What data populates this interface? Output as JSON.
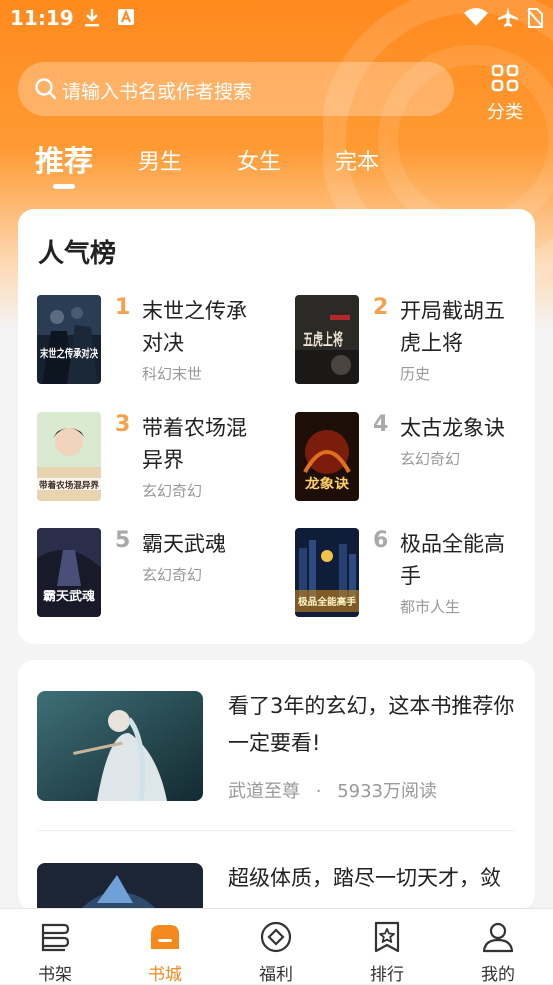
{
  "status_bar": {
    "time": "11:19",
    "icons": [
      "download-icon",
      "a-notification-icon",
      "wifi-icon",
      "airplane-mode-icon",
      "no-sim-icon"
    ]
  },
  "search": {
    "placeholder": "请输入书名或作者搜索",
    "category_label": "分类"
  },
  "tabs": [
    {
      "label": "推荐",
      "active": true
    },
    {
      "label": "男生",
      "active": false
    },
    {
      "label": "女生",
      "active": false
    },
    {
      "label": "完本",
      "active": false
    }
  ],
  "popular": {
    "title": "人气榜",
    "books": [
      {
        "rank": "1",
        "title": "末世之传承对决",
        "genre": "科幻末世",
        "cover_text": "末世之传承对决"
      },
      {
        "rank": "2",
        "title": "开局截胡五虎上将",
        "genre": "历史",
        "cover_text": "五虎上将"
      },
      {
        "rank": "3",
        "title": "带着农场混异界",
        "genre": "玄幻奇幻",
        "cover_text": "带着农场混异界"
      },
      {
        "rank": "4",
        "title": "太古龙象诀",
        "genre": "玄幻奇幻",
        "cover_text": "龙象诀"
      },
      {
        "rank": "5",
        "title": "霸天武魂",
        "genre": "玄幻奇幻",
        "cover_text": "霸天武魂"
      },
      {
        "rank": "6",
        "title": "极品全能高手",
        "genre": "都市人生",
        "cover_text": "极品全能高手"
      }
    ]
  },
  "articles": [
    {
      "title": "看了3年的玄幻，这本书推荐你一定要看!",
      "book": "武道至尊",
      "dot": "·",
      "reads": "5933万阅读"
    },
    {
      "title": "超级体质，踏尽一切天才，敛",
      "book": "",
      "dot": "",
      "reads": ""
    }
  ],
  "bottom_nav": [
    {
      "label": "书架",
      "icon": "bookshelf-icon",
      "active": false
    },
    {
      "label": "书城",
      "icon": "bookstore-icon",
      "active": true
    },
    {
      "label": "福利",
      "icon": "welfare-icon",
      "active": false
    },
    {
      "label": "排行",
      "icon": "ranking-icon",
      "active": false
    },
    {
      "label": "我的",
      "icon": "profile-icon",
      "active": false
    }
  ],
  "colors": {
    "accent": "#f5891d",
    "rank_top": "#f5a04a",
    "rank_other": "#a9a9a9"
  }
}
